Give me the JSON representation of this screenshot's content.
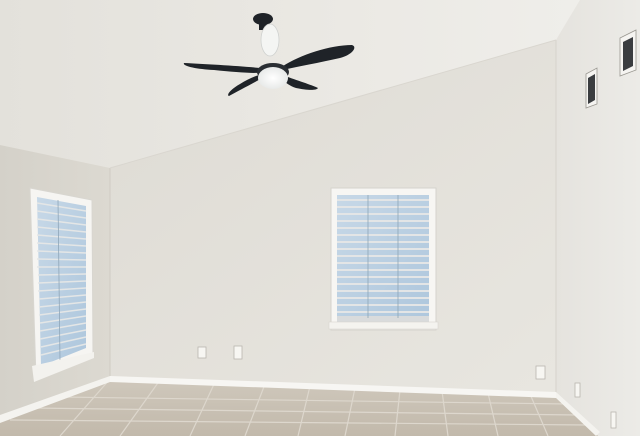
{
  "scene": {
    "description_free": true,
    "colors": {
      "ceiling_left": "#e9e7e2",
      "ceiling_right": "#ecebe7",
      "wall_back": "#e4e2dc",
      "wall_left": "#dcd9d2",
      "wall_right": "#e8e6e1",
      "floor_tile": "#c9c2b6",
      "grout": "#e2ddd5",
      "trim": "#f7f6f3",
      "fan_blade": "#1f2328",
      "fan_light": "#fbfbf8",
      "window_glass": "#b9cfe3",
      "blind_slat": "#dfe1e2"
    },
    "objects": [
      {
        "name": "ceiling-fan",
        "blades": 4
      },
      {
        "name": "window-left"
      },
      {
        "name": "window-center"
      },
      {
        "name": "wall-vent",
        "count": 2
      },
      {
        "name": "electrical-outlet",
        "count": 3
      },
      {
        "name": "light-switch-plate"
      },
      {
        "name": "tile-floor"
      },
      {
        "name": "baseboard"
      }
    ]
  }
}
